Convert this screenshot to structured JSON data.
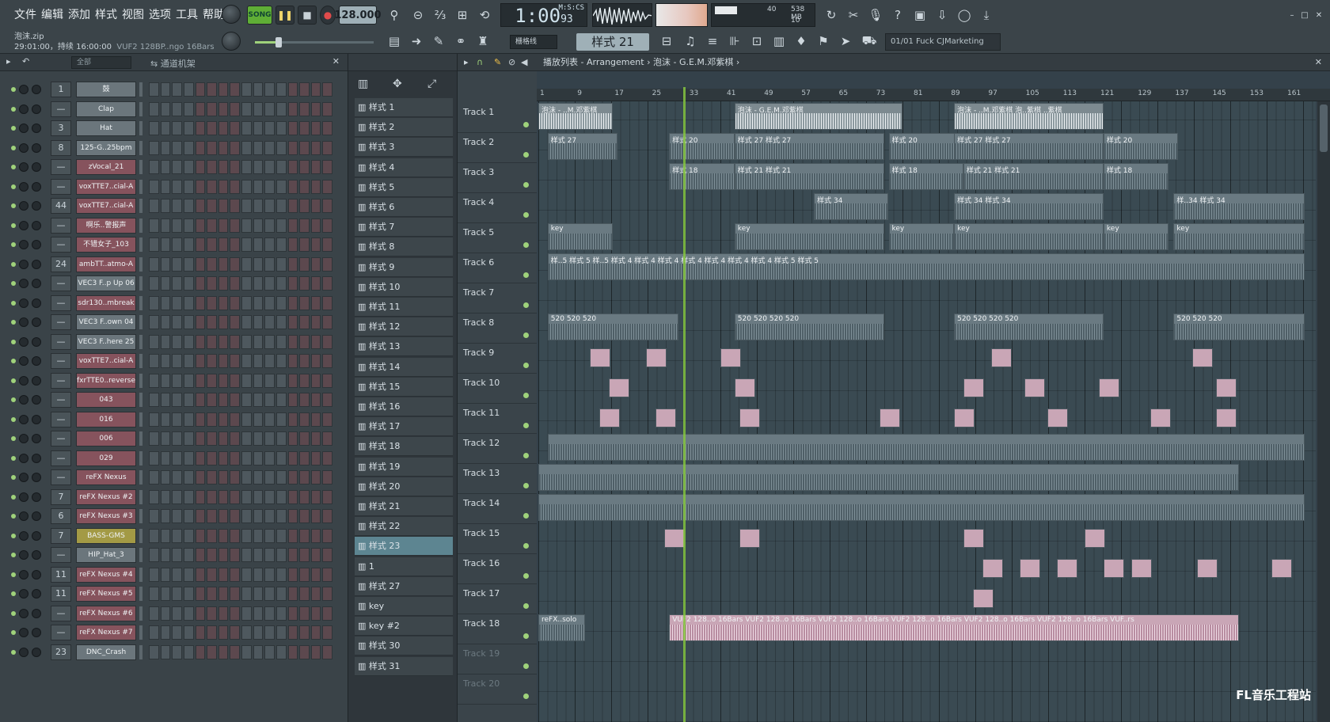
{
  "menu": [
    "文件",
    "编辑",
    "添加",
    "样式",
    "视图",
    "选项",
    "工具",
    "帮助"
  ],
  "project": {
    "file": "泡沫.zip",
    "info": "29:01:00，持续 16:00:00",
    "hint": "VUF2 128BP..ngo 16Bars"
  },
  "transport": {
    "song": "SONG",
    "bpm": "128.000",
    "time": "1:00",
    "time_sub": "93",
    "time_unit": "M:S:CS"
  },
  "cpu": {
    "top": "40",
    "mem": "538 MB",
    "bottom": "10"
  },
  "toolbar2": {
    "snap": "栅格线",
    "pattern": "样式 21",
    "hint": "01/01  Fuck CJMarketing"
  },
  "rack": {
    "filter": "全部",
    "title": "通道机架"
  },
  "channels": [
    {
      "num": "1",
      "name": "鼓",
      "color": "#6b767c"
    },
    {
      "num": "—",
      "name": "Clap",
      "color": "#6b767c"
    },
    {
      "num": "3",
      "name": "Hat",
      "color": "#6b767c"
    },
    {
      "num": "8",
      "name": "125-G..25bpm",
      "color": "#6b767c"
    },
    {
      "num": "—",
      "name": "zVocal_21",
      "color": "#86535d"
    },
    {
      "num": "—",
      "name": "voxTTE7..cial-A",
      "color": "#86535d"
    },
    {
      "num": "44",
      "name": "voxTTE7..cial-A",
      "color": "#86535d"
    },
    {
      "num": "—",
      "name": "啊乐..警报声",
      "color": "#86535d"
    },
    {
      "num": "—",
      "name": "不错女子_103",
      "color": "#86535d"
    },
    {
      "num": "24",
      "name": "ambTT..atmo-A",
      "color": "#86535d"
    },
    {
      "num": "—",
      "name": "VEC3 F..p Up 06",
      "color": "#6b767c"
    },
    {
      "num": "—",
      "name": "sdr130..mbreak",
      "color": "#86535d"
    },
    {
      "num": "—",
      "name": "VEC3 F..own 04",
      "color": "#6b767c"
    },
    {
      "num": "—",
      "name": "VEC3 F..here 25",
      "color": "#6b767c"
    },
    {
      "num": "—",
      "name": "voxTTE7..cial-A",
      "color": "#86535d"
    },
    {
      "num": "—",
      "name": "fxrTTE0..reverse",
      "color": "#86535d"
    },
    {
      "num": "—",
      "name": "043",
      "color": "#86535d"
    },
    {
      "num": "—",
      "name": "016",
      "color": "#86535d"
    },
    {
      "num": "—",
      "name": "006",
      "color": "#86535d"
    },
    {
      "num": "—",
      "name": "029",
      "color": "#86535d"
    },
    {
      "num": "—",
      "name": "reFX Nexus",
      "color": "#86535d"
    },
    {
      "num": "7",
      "name": "reFX Nexus #2",
      "color": "#86535d"
    },
    {
      "num": "6",
      "name": "reFX Nexus #3",
      "color": "#86535d"
    },
    {
      "num": "7",
      "name": "BASS-GMS",
      "color": "#a39a45"
    },
    {
      "num": "—",
      "name": "HIP_Hat_3",
      "color": "#6b767c"
    },
    {
      "num": "11",
      "name": "reFX Nexus #4",
      "color": "#86535d"
    },
    {
      "num": "11",
      "name": "reFX Nexus #5",
      "color": "#86535d"
    },
    {
      "num": "—",
      "name": "reFX Nexus #6",
      "color": "#86535d"
    },
    {
      "num": "—",
      "name": "reFX Nexus #7",
      "color": "#86535d"
    },
    {
      "num": "23",
      "name": "DNC_Crash",
      "color": "#6b767c"
    }
  ],
  "patterns": [
    "样式 1",
    "样式 2",
    "样式 3",
    "样式 4",
    "样式 5",
    "样式 6",
    "样式 7",
    "样式 8",
    "样式 9",
    "样式 10",
    "样式 11",
    "样式 12",
    "样式 13",
    "样式 14",
    "样式 15",
    "样式 16",
    "样式 17",
    "样式 18",
    "样式 19",
    "样式 20",
    "样式 21",
    "样式 22",
    "样式 23",
    "1",
    "样式 27",
    "key",
    "key #2",
    "样式 30",
    "样式 31"
  ],
  "active_pattern": "样式 23",
  "playlist": {
    "title": "播放列表 - Arrangement",
    "song": "泡沫 - G.E.M.邓紫棋"
  },
  "ruler": [
    "1",
    "9",
    "17",
    "25",
    "33",
    "41",
    "49",
    "57",
    "65",
    "73",
    "81",
    "89",
    "97",
    "105",
    "113",
    "121",
    "129",
    "137",
    "145",
    "153",
    "161"
  ],
  "tracks": [
    "Track 1",
    "Track 2",
    "Track 3",
    "Track 4",
    "Track 5",
    "Track 6",
    "Track 7",
    "Track 8",
    "Track 9",
    "Track 10",
    "Track 11",
    "Track 12",
    "Track 13",
    "Track 14",
    "Track 15",
    "Track 16",
    "Track 17",
    "Track 18",
    "Track 19",
    "Track 20"
  ],
  "dim_tracks": [
    "Track 19",
    "Track 20"
  ],
  "clips": [
    {
      "track": 0,
      "start": 1,
      "len": 16,
      "label": "泡沫 - ..M.邓紫棋",
      "kind": "audio"
    },
    {
      "track": 0,
      "start": 43,
      "len": 36,
      "label": "泡沫 - G.E.M.邓紫棋",
      "kind": "audio"
    },
    {
      "track": 0,
      "start": 90,
      "len": 32,
      "label": "泡沫 - ..M.邓紫棋  泡..紫棋  ..紫棋",
      "kind": "audio"
    },
    {
      "track": 1,
      "start": 3,
      "len": 15,
      "label": "样式 27",
      "kind": "pat"
    },
    {
      "track": 1,
      "start": 29,
      "len": 14,
      "label": "样式 20",
      "kind": "pat"
    },
    {
      "track": 1,
      "start": 43,
      "len": 32,
      "label": "样式 27   样式 27",
      "kind": "pat"
    },
    {
      "track": 1,
      "start": 76,
      "len": 16,
      "label": "样式 20",
      "kind": "pat"
    },
    {
      "track": 1,
      "start": 90,
      "len": 32,
      "label": "样式 27   样式 27",
      "kind": "pat"
    },
    {
      "track": 1,
      "start": 122,
      "len": 16,
      "label": "样式 20",
      "kind": "pat"
    },
    {
      "track": 2,
      "start": 29,
      "len": 14,
      "label": "样式 18",
      "kind": "pat"
    },
    {
      "track": 2,
      "start": 43,
      "len": 32,
      "label": "样式 21   样式 21",
      "kind": "pat"
    },
    {
      "track": 2,
      "start": 76,
      "len": 16,
      "label": "样式 18",
      "kind": "pat"
    },
    {
      "track": 2,
      "start": 92,
      "len": 30,
      "label": "样式 21   样式 21",
      "kind": "pat"
    },
    {
      "track": 2,
      "start": 122,
      "len": 14,
      "label": "样式 18",
      "kind": "pat"
    },
    {
      "track": 3,
      "start": 60,
      "len": 16,
      "label": "样式 34",
      "kind": "pat"
    },
    {
      "track": 3,
      "start": 90,
      "len": 32,
      "label": "样式 34   样式 34",
      "kind": "pat"
    },
    {
      "track": 3,
      "start": 137,
      "len": 28,
      "label": "样..34  样式 34",
      "kind": "pat"
    },
    {
      "track": 4,
      "start": 3,
      "len": 14,
      "label": "key",
      "kind": "pat"
    },
    {
      "track": 4,
      "start": 43,
      "len": 32,
      "label": "key",
      "kind": "pat"
    },
    {
      "track": 4,
      "start": 76,
      "len": 14,
      "label": "key",
      "kind": "pat"
    },
    {
      "track": 4,
      "start": 90,
      "len": 32,
      "label": "key",
      "kind": "pat"
    },
    {
      "track": 4,
      "start": 122,
      "len": 14,
      "label": "key",
      "kind": "pat"
    },
    {
      "track": 4,
      "start": 137,
      "len": 28,
      "label": "key",
      "kind": "pat"
    },
    {
      "track": 5,
      "start": 3,
      "len": 162,
      "label": "样..5 样式 5 样..5 样式 4   样式 4   样式 4   样式 4   样式 4   样式 4   样式 4 样式 5 样式 5",
      "kind": "pat"
    },
    {
      "track": 7,
      "start": 3,
      "len": 28,
      "label": "520  520  520",
      "kind": "pat"
    },
    {
      "track": 7,
      "start": 43,
      "len": 32,
      "label": "520  520  520  520",
      "kind": "pat"
    },
    {
      "track": 7,
      "start": 90,
      "len": 32,
      "label": "520  520  520  520",
      "kind": "pat"
    },
    {
      "track": 7,
      "start": 137,
      "len": 28,
      "label": "520  520  520",
      "kind": "pat"
    },
    {
      "track": 11,
      "start": 3,
      "len": 162,
      "label": "",
      "kind": "pat"
    },
    {
      "track": 12,
      "start": 1,
      "len": 150,
      "label": "",
      "kind": "pat"
    },
    {
      "track": 13,
      "start": 1,
      "len": 164,
      "label": "",
      "kind": "pat"
    },
    {
      "track": 17,
      "start": 1,
      "len": 10,
      "label": "reFX..solo",
      "kind": "pat"
    },
    {
      "track": 17,
      "start": 29,
      "len": 122,
      "label": "VUF2 128..o 16Bars  VUF2 128..o 16Bars  VUF2 128..o 16Bars  VUF2 128..o 16Bars  VUF2 128..o 16Bars  VUF2 128..o 16Bars  VUF..rs",
      "kind": "pink"
    }
  ],
  "playhead_bar": 32,
  "watermark": "FL音乐工程站",
  "icons": [
    "metronome-icon",
    "record-icon",
    "undo-icon",
    "mixer-icon",
    "piano-roll-icon",
    "browser-icon",
    "plugin-icon",
    "help-icon",
    "save-icon"
  ]
}
